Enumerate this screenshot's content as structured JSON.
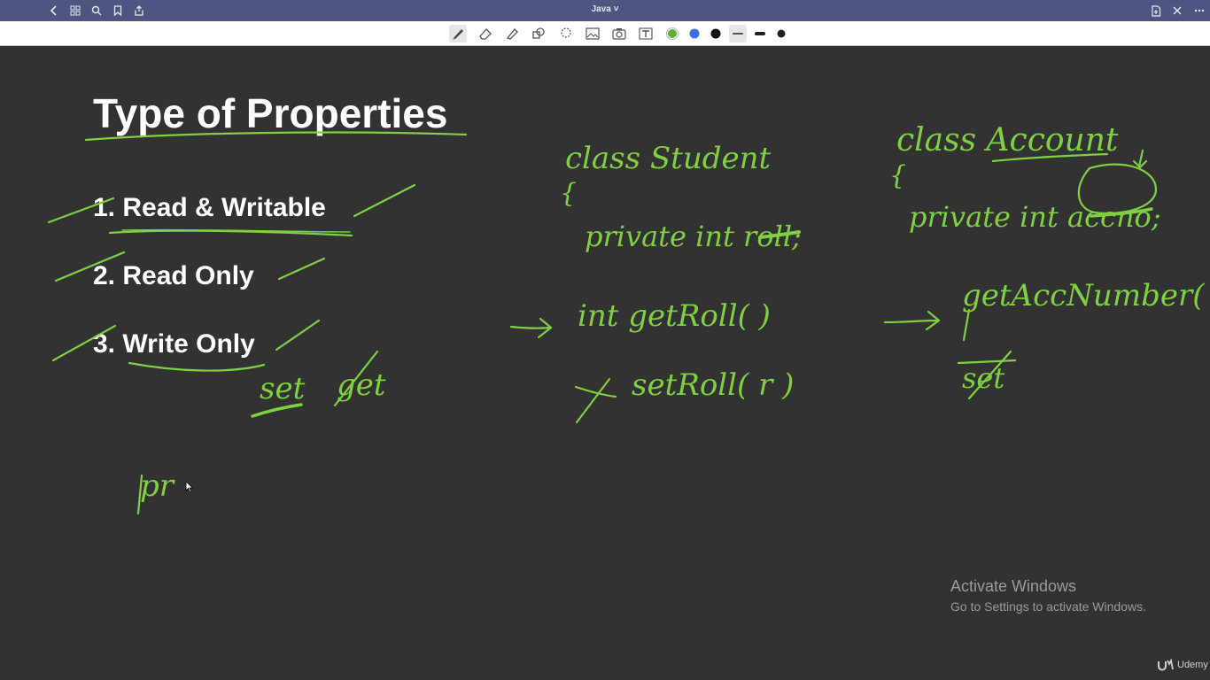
{
  "window": {
    "title": "Java ˅"
  },
  "titlebar": {
    "icons": [
      "back-chevron-icon",
      "grid-icon",
      "search-icon",
      "bookmark-icon",
      "share-icon",
      "export-page-icon",
      "close-icon",
      "more-dots-icon"
    ]
  },
  "toolbar": {
    "tools": [
      "pen-tool-icon",
      "eraser-icon",
      "highlighter-icon",
      "shapes-icon",
      "lasso-icon",
      "image-icon",
      "camera-icon",
      "text-box-icon"
    ],
    "colors": [
      "#5cb130",
      "#3d6fe0",
      "#111111"
    ],
    "selected_color": "#5cb130",
    "stroke_widths": [
      "thin",
      "medium",
      "thick"
    ],
    "selected_stroke": "thin"
  },
  "slide": {
    "title": "Type of Properties",
    "items": [
      "1. Read & Writable",
      "2. Read Only",
      "3. Write Only"
    ]
  },
  "ink": {
    "color": "#7fd042",
    "words": [
      "class Student",
      "{",
      "private int roll;",
      "int getRoll( )",
      "setRoll( r )",
      "class Account",
      "{",
      "private int accno;",
      "getAccNumber( )",
      "set",
      "set",
      "get",
      "pr"
    ]
  },
  "overlay": {
    "activate_heading": "Activate Windows",
    "activate_sub": "Go to Settings to activate Windows.",
    "brand": "Udemy"
  }
}
